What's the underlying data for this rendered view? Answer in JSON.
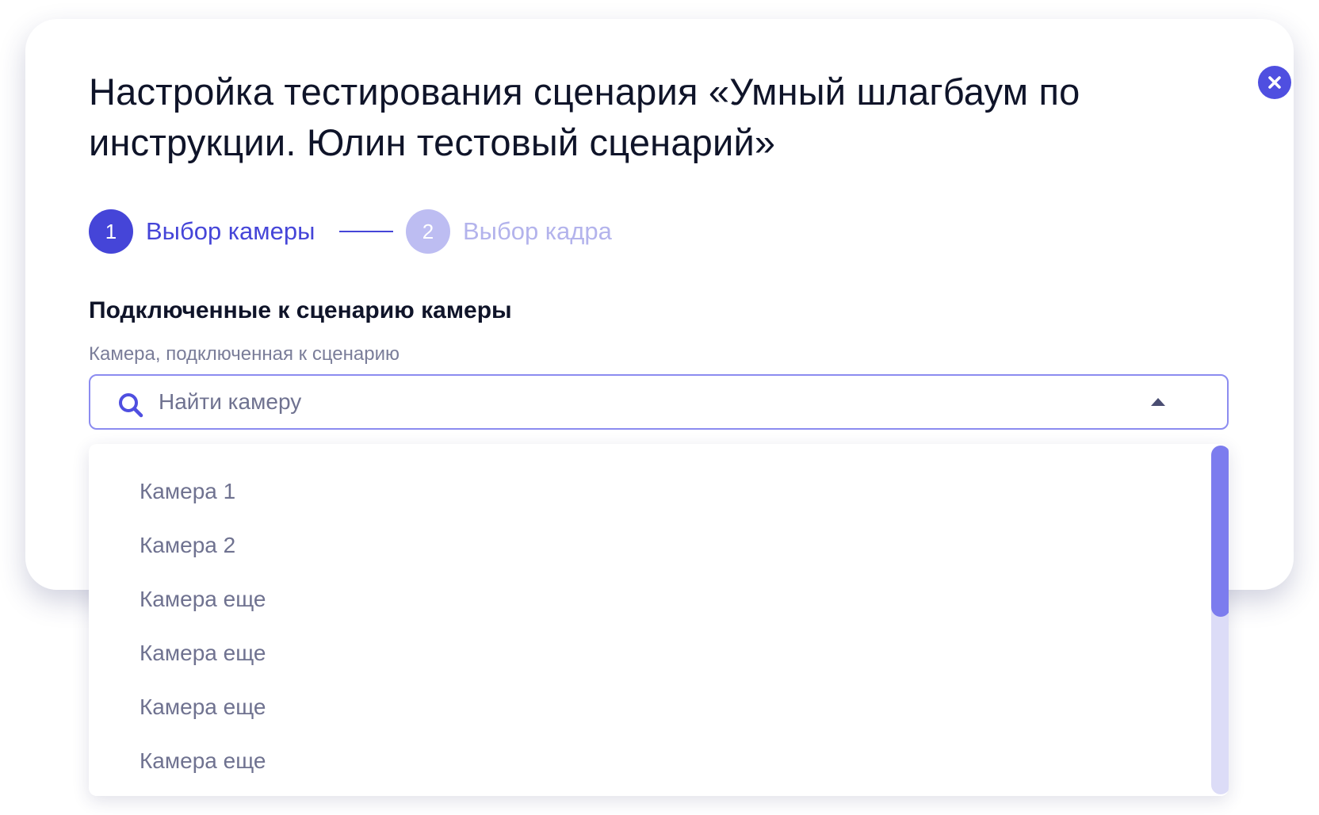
{
  "dialog": {
    "title": "Настройка тестирования сценария «Умный шлагбаум по инструкции. Юлин тестовый сценарий»",
    "close_icon": "close-icon"
  },
  "stepper": {
    "steps": [
      {
        "number": "1",
        "label": "Выбор камеры",
        "state": "active"
      },
      {
        "number": "2",
        "label": "Выбор кадра",
        "state": "inactive"
      }
    ]
  },
  "section": {
    "heading": "Подключенные к сценарию камеры",
    "field_label": "Камера, подключенная к сценарию"
  },
  "search": {
    "placeholder": "Найти камеру",
    "value": "",
    "icon": "search-icon",
    "toggle_icon": "chevron-up-icon"
  },
  "dropdown": {
    "options": [
      "Камера 1",
      "Камера 2",
      "Камера еще",
      "Камера еще",
      "Камера еще",
      "Камера еще"
    ],
    "scroll_position": 0
  },
  "colors": {
    "accent": "#4545d8",
    "accent_light": "#bdbdf2",
    "text_primary": "#0f1429",
    "text_muted": "#6f7290"
  }
}
